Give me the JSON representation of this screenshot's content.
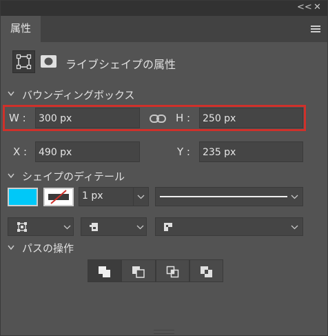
{
  "window": {
    "collapse_label": "<<",
    "close_label": "✕"
  },
  "tab": {
    "label": "属性"
  },
  "header": {
    "title": "ライブシェイプの属性"
  },
  "sections": {
    "bounding_box": "バウンディングボックス",
    "shape_details": "シェイプのディテール",
    "path_ops": "パスの操作"
  },
  "bbox": {
    "w_label": "W :",
    "w_value": "300 px",
    "h_label": "H :",
    "h_value": "250 px",
    "x_label": "X :",
    "x_value": "490 px",
    "y_label": "Y :",
    "y_value": "235 px"
  },
  "details": {
    "fill_color": "#00c8f8",
    "stroke_width": "1 px"
  },
  "colors": {
    "highlight": "#d0302a"
  },
  "icons": {
    "collapse": "double-chevron-left-icon",
    "close": "close-icon",
    "menu": "hamburger-menu-icon",
    "link": "link-chain-icon"
  }
}
